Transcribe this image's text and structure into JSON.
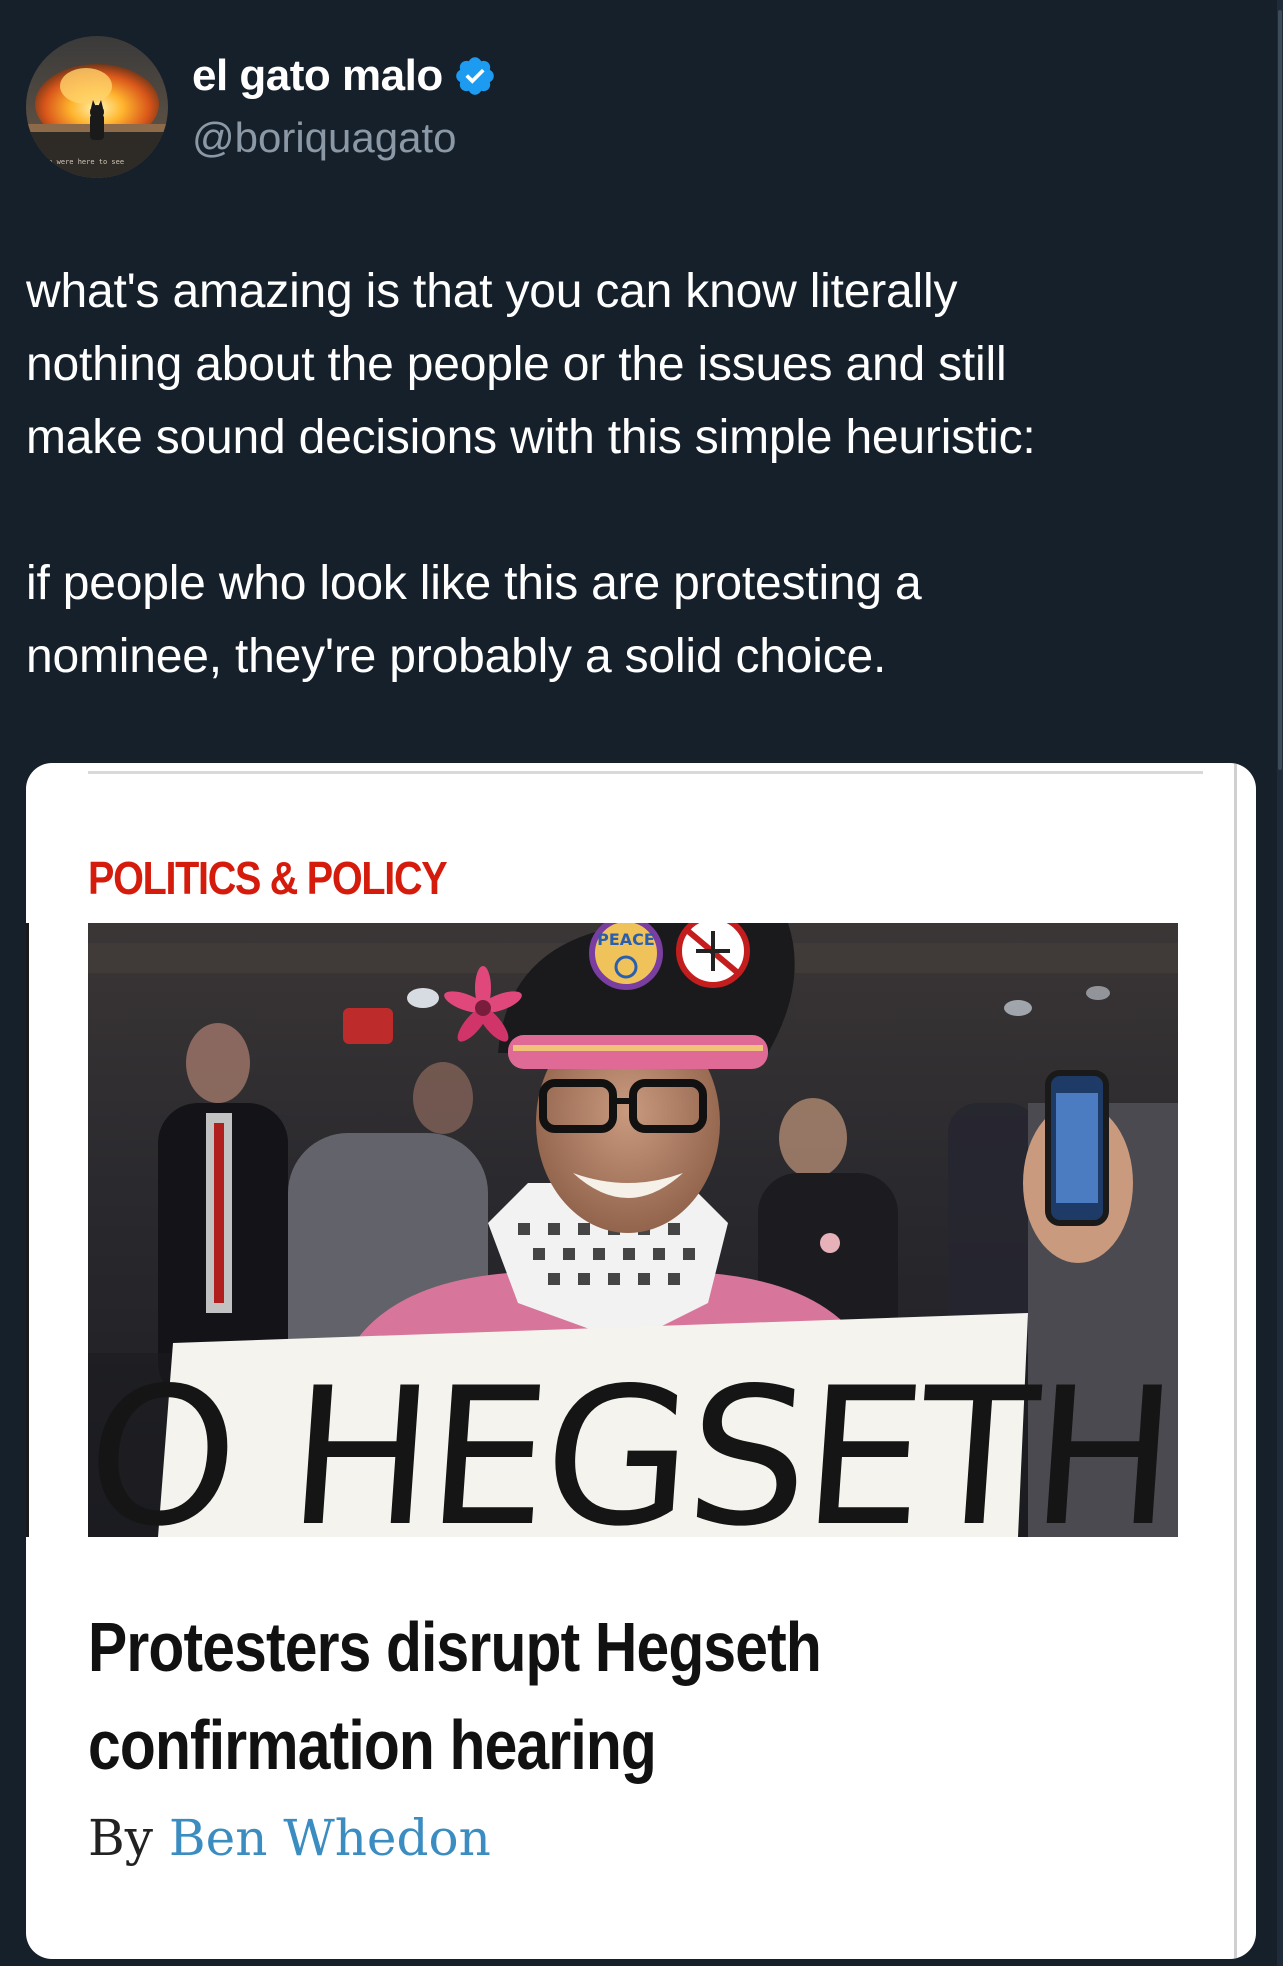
{
  "tweet": {
    "author": {
      "display_name": "el gato malo",
      "handle": "@boriquagato",
      "verified": true,
      "avatar_icon": "avatar-explosion-cat-icon",
      "avatar_caption": "we were here to see"
    },
    "text": "what's amazing is that you can know literally\nnothing about the people or the issues and still\nmake sound decisions with this simple heuristic:\n\nif people who look like this are protesting a\nnominee, they're probably a solid choice."
  },
  "card": {
    "section": "POLITICS & POLICY",
    "photo": {
      "icon": "protester-photo",
      "sign_text": "NO HEGSETH",
      "badge_text": "PEACE"
    },
    "headline": "Protesters disrupt Hegseth\nconfirmation hearing",
    "byline_prefix": "By",
    "byline_author": "Ben Whedon"
  },
  "colors": {
    "background": "#15202b",
    "handle": "#8b98a5",
    "verified": "#1d9bf0",
    "section_label": "#d51b0c",
    "author_link": "#3a8cc1"
  }
}
